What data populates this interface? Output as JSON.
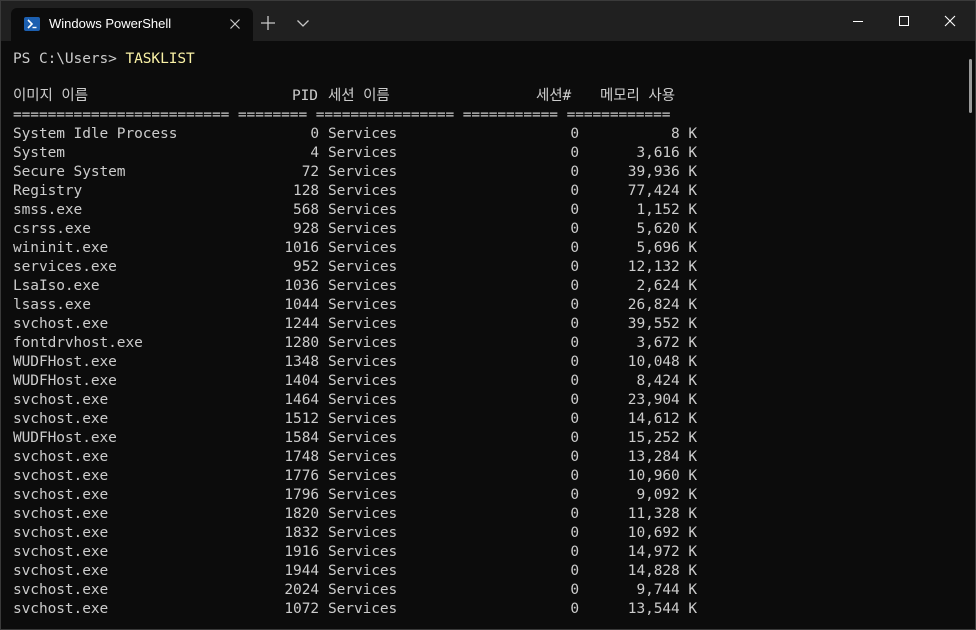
{
  "window": {
    "tab_title": "Windows PowerShell",
    "colors": {
      "titlebar": "#202020",
      "background": "#0c0c0c",
      "text": "#cccccc",
      "command": "#f9f1a5",
      "icon": "#1c5fb0"
    }
  },
  "prompt": {
    "text": "PS C:\\Users>",
    "command": "TASKLIST"
  },
  "headers": {
    "image_name": "이미지 이름",
    "pid": "PID",
    "session_name": "세션 이름",
    "session_num": "세션#",
    "mem_usage": "메모리 사용"
  },
  "separator": "========================= ======== ================ =========== ============",
  "processes": [
    {
      "name": "System Idle Process",
      "pid": "0",
      "session": "Services",
      "num": "0",
      "mem": "8 K"
    },
    {
      "name": "System",
      "pid": "4",
      "session": "Services",
      "num": "0",
      "mem": "3,616 K"
    },
    {
      "name": "Secure System",
      "pid": "72",
      "session": "Services",
      "num": "0",
      "mem": "39,936 K"
    },
    {
      "name": "Registry",
      "pid": "128",
      "session": "Services",
      "num": "0",
      "mem": "77,424 K"
    },
    {
      "name": "smss.exe",
      "pid": "568",
      "session": "Services",
      "num": "0",
      "mem": "1,152 K"
    },
    {
      "name": "csrss.exe",
      "pid": "928",
      "session": "Services",
      "num": "0",
      "mem": "5,620 K"
    },
    {
      "name": "wininit.exe",
      "pid": "1016",
      "session": "Services",
      "num": "0",
      "mem": "5,696 K"
    },
    {
      "name": "services.exe",
      "pid": "952",
      "session": "Services",
      "num": "0",
      "mem": "12,132 K"
    },
    {
      "name": "LsaIso.exe",
      "pid": "1036",
      "session": "Services",
      "num": "0",
      "mem": "2,624 K"
    },
    {
      "name": "lsass.exe",
      "pid": "1044",
      "session": "Services",
      "num": "0",
      "mem": "26,824 K"
    },
    {
      "name": "svchost.exe",
      "pid": "1244",
      "session": "Services",
      "num": "0",
      "mem": "39,552 K"
    },
    {
      "name": "fontdrvhost.exe",
      "pid": "1280",
      "session": "Services",
      "num": "0",
      "mem": "3,672 K"
    },
    {
      "name": "WUDFHost.exe",
      "pid": "1348",
      "session": "Services",
      "num": "0",
      "mem": "10,048 K"
    },
    {
      "name": "WUDFHost.exe",
      "pid": "1404",
      "session": "Services",
      "num": "0",
      "mem": "8,424 K"
    },
    {
      "name": "svchost.exe",
      "pid": "1464",
      "session": "Services",
      "num": "0",
      "mem": "23,904 K"
    },
    {
      "name": "svchost.exe",
      "pid": "1512",
      "session": "Services",
      "num": "0",
      "mem": "14,612 K"
    },
    {
      "name": "WUDFHost.exe",
      "pid": "1584",
      "session": "Services",
      "num": "0",
      "mem": "15,252 K"
    },
    {
      "name": "svchost.exe",
      "pid": "1748",
      "session": "Services",
      "num": "0",
      "mem": "13,284 K"
    },
    {
      "name": "svchost.exe",
      "pid": "1776",
      "session": "Services",
      "num": "0",
      "mem": "10,960 K"
    },
    {
      "name": "svchost.exe",
      "pid": "1796",
      "session": "Services",
      "num": "0",
      "mem": "9,092 K"
    },
    {
      "name": "svchost.exe",
      "pid": "1820",
      "session": "Services",
      "num": "0",
      "mem": "11,328 K"
    },
    {
      "name": "svchost.exe",
      "pid": "1832",
      "session": "Services",
      "num": "0",
      "mem": "10,692 K"
    },
    {
      "name": "svchost.exe",
      "pid": "1916",
      "session": "Services",
      "num": "0",
      "mem": "14,972 K"
    },
    {
      "name": "svchost.exe",
      "pid": "1944",
      "session": "Services",
      "num": "0",
      "mem": "14,828 K"
    },
    {
      "name": "svchost.exe",
      "pid": "2024",
      "session": "Services",
      "num": "0",
      "mem": "9,744 K"
    },
    {
      "name": "svchost.exe",
      "pid": "1072",
      "session": "Services",
      "num": "0",
      "mem": "13,544 K"
    }
  ]
}
